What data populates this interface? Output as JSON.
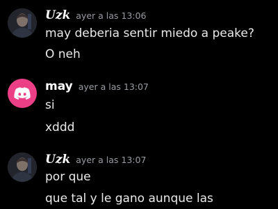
{
  "messages": [
    {
      "author": "Uzk",
      "timestamp": "ayer a las 13:06",
      "avatar": "uzk-profile-photo",
      "lines": [
        "may deberia sentir miedo a peake?",
        "O neh"
      ]
    },
    {
      "author": "may",
      "timestamp": "ayer a las 13:07",
      "avatar": "discord-logo-icon",
      "avatar_color": "#ed3f86",
      "lines": [
        "si",
        "xddd"
      ]
    },
    {
      "author": "Uzk",
      "timestamp": "ayer a las 13:07",
      "avatar": "uzk-profile-photo",
      "lines": [
        "por que",
        "que tal y le gano aunque las"
      ]
    }
  ]
}
